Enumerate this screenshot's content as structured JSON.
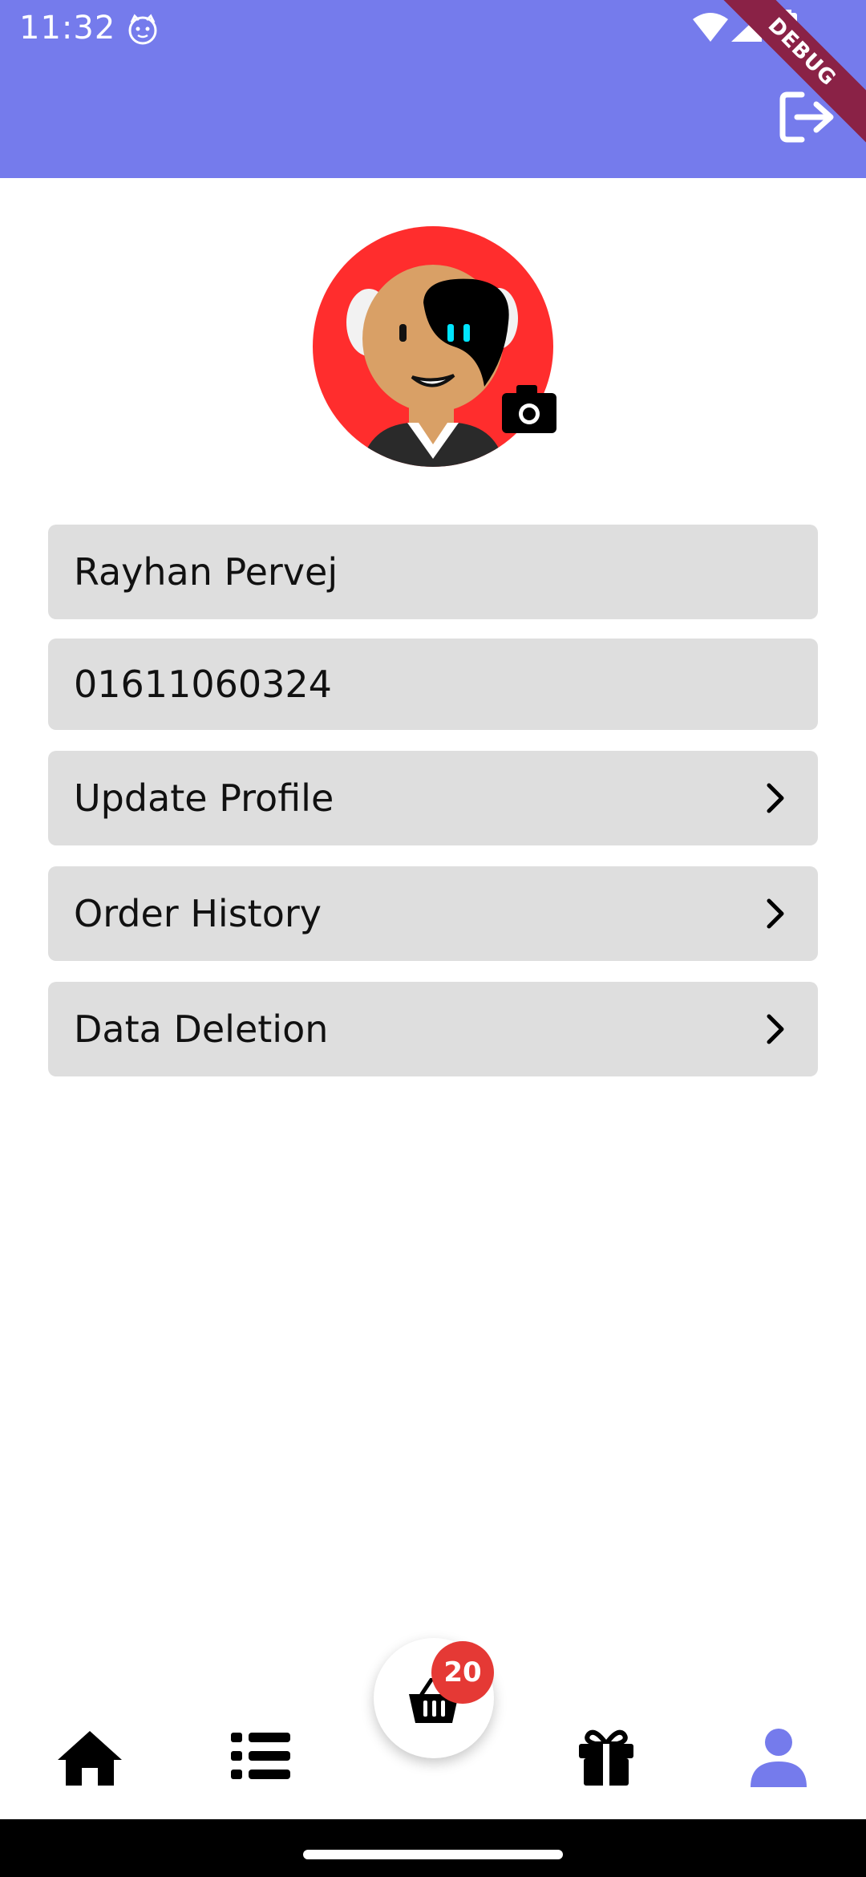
{
  "status_bar": {
    "time": "11:32",
    "icons": [
      "cat-notification-icon",
      "wifi-icon",
      "signal-icon",
      "battery-icon"
    ]
  },
  "debug_banner": "DEBUG",
  "app_bar": {
    "background_color": "#757BEC",
    "actions": [
      "logout-icon"
    ]
  },
  "profile": {
    "avatar_icon": "cartoon-avatar-icon",
    "avatar_background": "#FF2D2D",
    "edit_photo_icon": "camera-icon",
    "name": "Rayhan Pervej",
    "phone": "01611060324"
  },
  "menu": [
    {
      "label": "Update Profile",
      "icon": "chevron-right-icon"
    },
    {
      "label": "Order History",
      "icon": "chevron-right-icon"
    },
    {
      "label": "Data Deletion",
      "icon": "chevron-right-icon"
    }
  ],
  "bottom_nav": {
    "items": [
      "home-icon",
      "list-icon",
      "cart-icon",
      "gift-icon",
      "person-icon"
    ],
    "active": "person-icon",
    "active_color": "#757BEC",
    "cart_badge": "20",
    "badge_color": "#E53935"
  }
}
